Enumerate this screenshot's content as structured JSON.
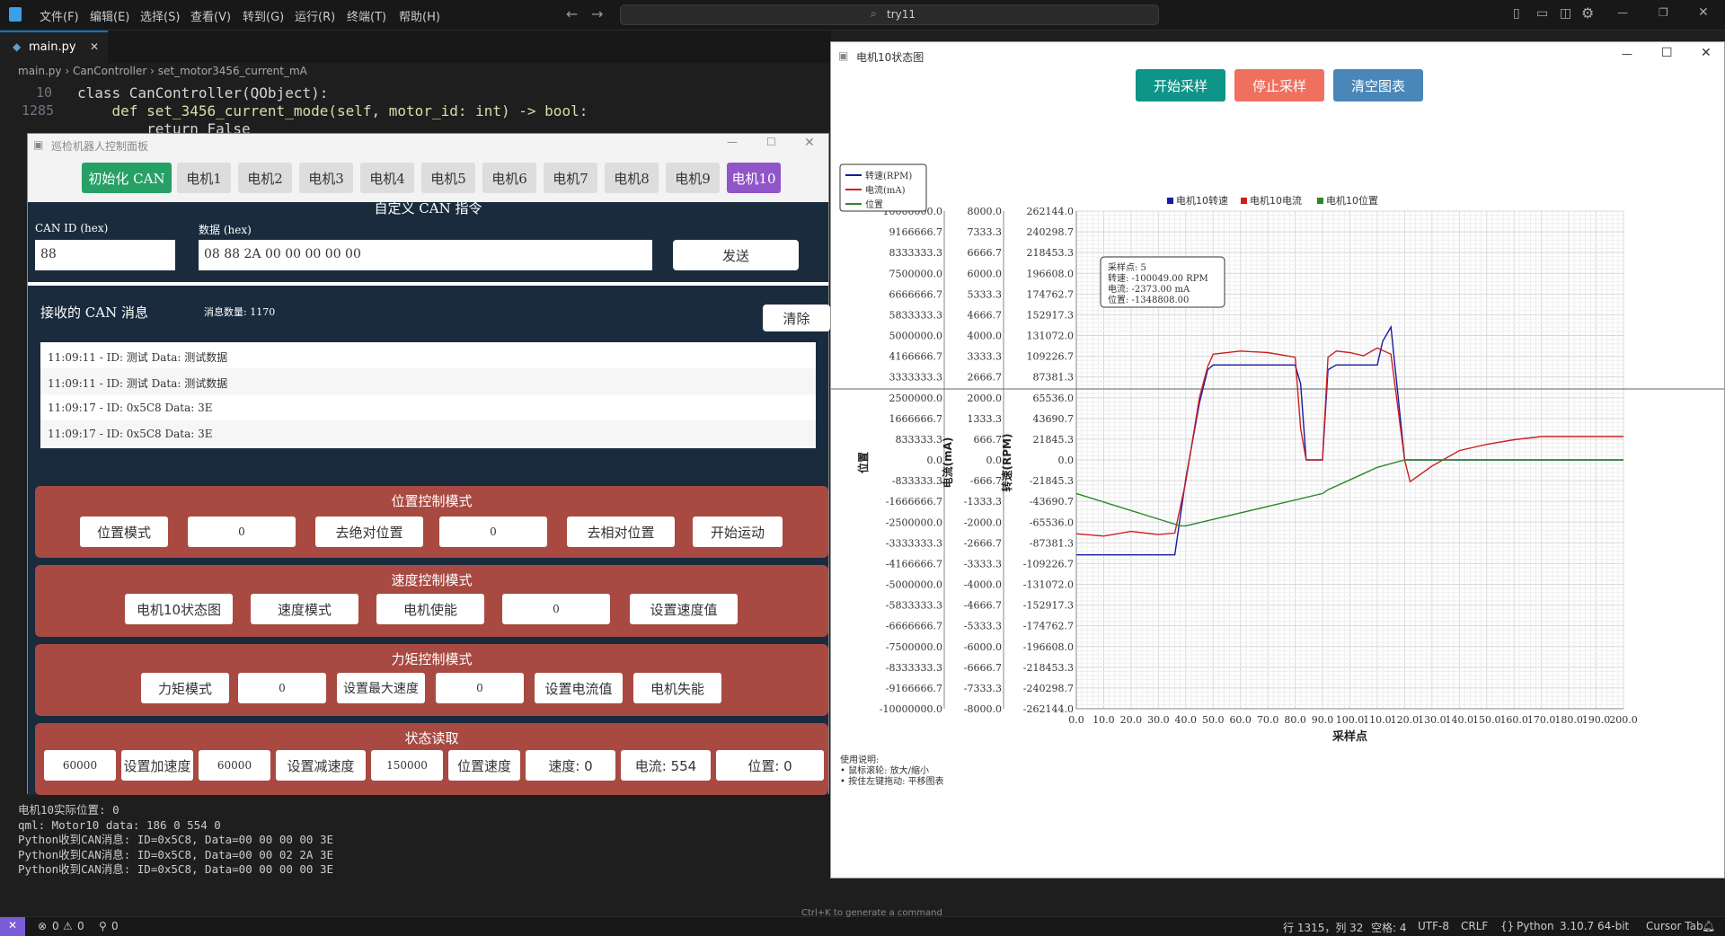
{
  "vscode": {
    "menu": [
      "文件(F)",
      "编辑(E)",
      "选择(S)",
      "查看(V)",
      "转到(G)",
      "运行(R)",
      "终端(T)",
      "帮助(H)"
    ],
    "search": "try11",
    "tab": "main.py",
    "breadcrumb": [
      "main.py",
      "CanController",
      "set_motor3456_current_mA"
    ],
    "line_numbers": [
      "10",
      "1285"
    ],
    "code_line1": "class CanController(QObject):",
    "code_line2": "    def set_3456_current_mode(self, motor_id: int) -> bool:",
    "code_line3": "        return False",
    "terminal": [
      "电机10实际位置: 0",
      "qml: Motor10 data: 186 0 554 0",
      "Python收到CAN消息: ID=0x5C8, Data=00 00 00 00 3E",
      "Python收到CAN消息: ID=0x5C8, Data=00 00 02 2A 3E",
      "Python收到CAN消息: ID=0x5C8, Data=00 00 00 00 3E"
    ],
    "status_left": [
      "0",
      "0",
      "0"
    ],
    "status_right": [
      "行 1315，列 32",
      "空格: 4",
      "UTF-8",
      "CRLF",
      "Python",
      "3.10.7 64-bit",
      "Cursor Tab"
    ],
    "hint": "Ctrl+K to generate a command"
  },
  "panel": {
    "title": "巡检机器人控制面板",
    "init_btn": "初始化 CAN",
    "motors": [
      "电机1",
      "电机2",
      "电机3",
      "电机4",
      "电机5",
      "电机6",
      "电机7",
      "电机8",
      "电机9",
      "电机10"
    ],
    "custom_title": "自定义 CAN 指令",
    "can_id_label": "CAN ID (hex)",
    "can_id_value": "88",
    "data_label": "数据 (hex)",
    "data_value": "08 88 2A 00 00 00 00 00",
    "send": "发送",
    "recv_title": "接收的 CAN 消息",
    "msg_count": "消息数量: 1170",
    "clear": "清除",
    "messages": [
      "11:09:11 - ID: 测试 Data: 测试数据",
      "11:09:11 - ID: 测试 Data: 测试数据",
      "11:09:17 - ID: 0x5C8 Data: 3E",
      "11:09:17 - ID: 0x5C8 Data: 3E"
    ],
    "pos_title": "位置控制模式",
    "pos": [
      "位置模式",
      "0",
      "去绝对位置",
      "0",
      "去相对位置",
      "开始运动"
    ],
    "spd_title": "速度控制模式",
    "spd": [
      "电机10状态图",
      "速度模式",
      "电机使能",
      "0",
      "设置速度值"
    ],
    "trq_title": "力矩控制模式",
    "trq": [
      "力矩模式",
      "0",
      "设置最大速度",
      "0",
      "设置电流值",
      "电机失能"
    ],
    "st_title": "状态读取",
    "st": [
      "60000",
      "设置加速度",
      "60000",
      "设置减速度",
      "150000",
      "位置速度",
      "速度: 0",
      "电流: 554",
      "位置: 0"
    ]
  },
  "chart_window": {
    "title": "电机10状态图",
    "start": "开始采样",
    "stop": "停止采样",
    "clear": "清空图表",
    "colors": {
      "start": "#0f9488",
      "stop": "#f07060",
      "clear": "#4a86b8",
      "speed": "#1a1aa0",
      "current": "#cc2020",
      "position": "#2a8a2a"
    },
    "legend_box": [
      "转速(RPM)",
      "电流(mA)",
      "位置"
    ],
    "legend_top": [
      "电机10转速",
      "电机10电流",
      "电机10位置"
    ],
    "tooltip": [
      "采样点: 5",
      "转速: -100049.00 RPM",
      "电流: -2373.00 mA",
      "位置: -1348808.00"
    ],
    "usage": [
      "使用说明:",
      "• 鼠标滚轮: 放大/缩小",
      "• 按住左键拖动: 平移图表"
    ]
  },
  "chart_data": {
    "type": "line",
    "xlabel": "采样点",
    "x_ticks": [
      "0.0",
      "10.0",
      "20.0",
      "30.0",
      "40.0",
      "50.0",
      "60.0",
      "70.0",
      "80.0",
      "90.0",
      "100.0",
      "110.0",
      "120.0",
      "130.0",
      "140.0",
      "150.0",
      "160.0",
      "170.0",
      "180.0",
      "190.0",
      "200.0"
    ],
    "xlim": [
      0,
      200
    ],
    "axes": [
      {
        "label": "位置",
        "ticks": [
          "10000000.0",
          "9166666.7",
          "8333333.3",
          "7500000.0",
          "6666666.7",
          "5833333.3",
          "5000000.0",
          "4166666.7",
          "3333333.3",
          "2500000.0",
          "1666666.7",
          "833333.3",
          "0.0",
          "-833333.3",
          "-1666666.7",
          "-2500000.0",
          "-3333333.3",
          "-4166666.7",
          "-5000000.0",
          "-5833333.3",
          "-6666666.7",
          "-7500000.0",
          "-8333333.3",
          "-9166666.7",
          "-10000000.0"
        ],
        "ylim": [
          -10000000,
          10000000
        ]
      },
      {
        "label": "电流(mA)",
        "ticks": [
          "8000.0",
          "7333.3",
          "6666.7",
          "6000.0",
          "5333.3",
          "4666.7",
          "4000.0",
          "3333.3",
          "2666.7",
          "2000.0",
          "1333.3",
          "666.7",
          "0.0",
          "-666.7",
          "-1333.3",
          "-2000.0",
          "-2666.7",
          "-3333.3",
          "-4000.0",
          "-4666.7",
          "-5333.3",
          "-6000.0",
          "-6666.7",
          "-7333.3",
          "-8000.0"
        ],
        "ylim": [
          -8000,
          8000
        ]
      },
      {
        "label": "转速(RPM)",
        "ticks": [
          "262144.0",
          "240298.7",
          "218453.3",
          "196608.0",
          "174762.7",
          "152917.3",
          "131072.0",
          "109226.7",
          "87381.3",
          "65536.0",
          "43690.7",
          "21845.3",
          "0.0",
          "-21845.3",
          "-43690.7",
          "-65536.0",
          "-87381.3",
          "-109226.7",
          "-131072.0",
          "-152917.3",
          "-174762.7",
          "-196608.0",
          "-218453.3",
          "-240298.7",
          "-262144.0"
        ],
        "ylim": [
          -262144,
          262144
        ]
      }
    ],
    "series": [
      {
        "name": "电机10转速",
        "axis": "转速(RPM)",
        "x": [
          0,
          36,
          40,
          45,
          48,
          50,
          80,
          82,
          84,
          90,
          92,
          95,
          110,
          112,
          115,
          120,
          122,
          200
        ],
        "y": [
          -100049,
          -100049,
          -20000,
          60000,
          95000,
          100000,
          100000,
          80000,
          0,
          0,
          95000,
          100000,
          100000,
          125000,
          140000,
          0,
          0,
          0
        ]
      },
      {
        "name": "电机10电流",
        "axis": "电流(mA)",
        "x": [
          0,
          10,
          20,
          30,
          36,
          40,
          45,
          48,
          50,
          60,
          70,
          80,
          82,
          84,
          90,
          92,
          95,
          100,
          105,
          110,
          115,
          120,
          122,
          130,
          140,
          150,
          160,
          170,
          180,
          190,
          200
        ],
        "y": [
          -2373,
          -2450,
          -2300,
          -2400,
          -2350,
          -700,
          2000,
          3000,
          3400,
          3500,
          3450,
          3300,
          1000,
          0,
          0,
          3300,
          3500,
          3450,
          3350,
          3600,
          3400,
          0,
          -700,
          -200,
          300,
          500,
          650,
          750,
          750,
          750,
          750
        ]
      },
      {
        "name": "电机10位置",
        "axis": "位置",
        "x": [
          0,
          38,
          40,
          90,
          92,
          100,
          110,
          120,
          130,
          200
        ],
        "y": [
          -1348808,
          -2650000,
          -2650000,
          -1350000,
          -1200000,
          -800000,
          -300000,
          0,
          0,
          0
        ]
      }
    ]
  }
}
